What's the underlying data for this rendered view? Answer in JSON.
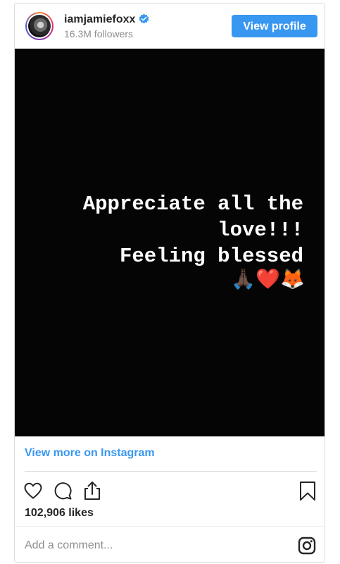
{
  "header": {
    "username": "iamjamiefoxx",
    "followers": "16.3M followers",
    "view_profile_label": "View profile"
  },
  "post": {
    "text_lines": [
      "Appreciate all the",
      "love!!!",
      "Feeling blessed"
    ],
    "emojis": "🙏🏿❤️🦊",
    "background_color": "#050505"
  },
  "footer": {
    "view_more_label": "View more on Instagram",
    "likes": "102,906 likes",
    "comment_placeholder": "Add a comment..."
  },
  "icons": [
    "heart-icon",
    "comment-icon",
    "share-icon",
    "bookmark-icon",
    "instagram-icon",
    "verified-badge-icon"
  ],
  "colors": {
    "accent": "#3897f0",
    "text": "#262626",
    "muted": "#8e8e8e"
  }
}
